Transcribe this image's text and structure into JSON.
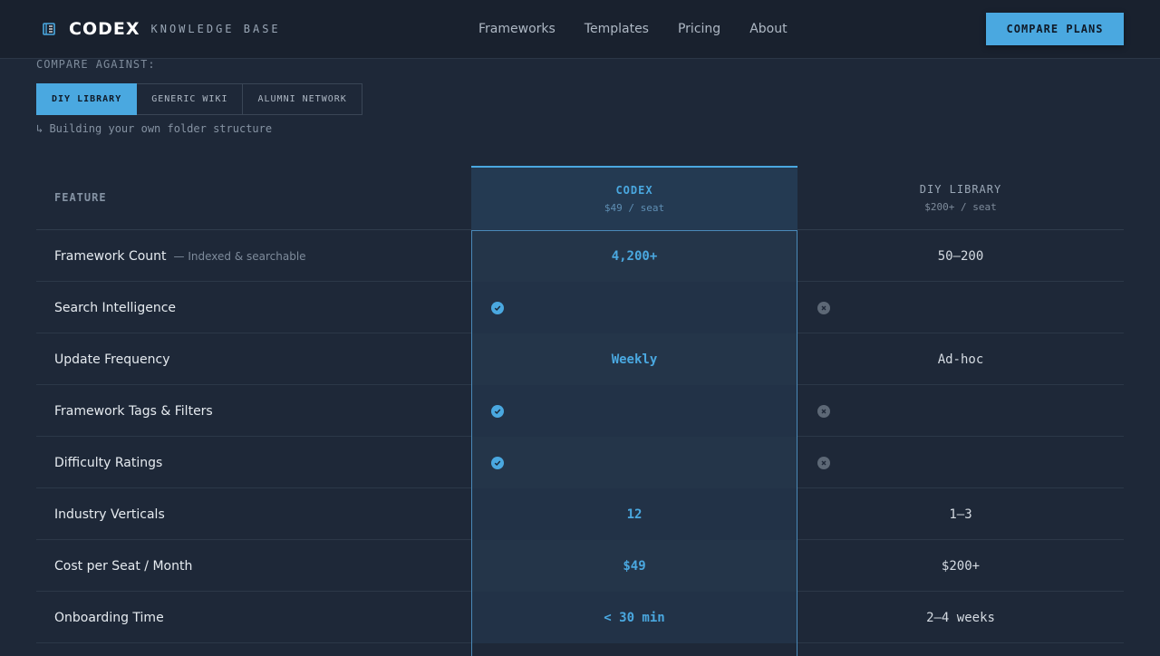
{
  "header": {
    "brand_name": "CODEX",
    "brand_sub": "KNOWLEDGE BASE",
    "nav": [
      "Frameworks",
      "Templates",
      "Pricing",
      "About"
    ],
    "cta_label": "COMPARE PLANS"
  },
  "compare": {
    "label": "COMPARE AGAINST:",
    "options": [
      "DIY LIBRARY",
      "GENERIC WIKI",
      "ALUMNI NETWORK"
    ],
    "selected": "DIY LIBRARY",
    "hint": "↳ Building your own folder structure"
  },
  "table": {
    "feature_header": "FEATURE",
    "codex_header": "CODEX",
    "codex_price": "$49 / seat",
    "diy_header": "DIY LIBRARY",
    "diy_price": "$200+ / seat",
    "rows": [
      {
        "feature": "Framework Count",
        "note": "— Indexed & searchable",
        "codex": "4,200+",
        "diy": "50–200"
      },
      {
        "feature": "Search Intelligence",
        "note": "",
        "codex": "check",
        "diy": "cross"
      },
      {
        "feature": "Update Frequency",
        "note": "",
        "codex": "Weekly",
        "diy": "Ad-hoc"
      },
      {
        "feature": "Framework Tags & Filters",
        "note": "",
        "codex": "check",
        "diy": "cross"
      },
      {
        "feature": "Difficulty Ratings",
        "note": "",
        "codex": "check",
        "diy": "cross"
      },
      {
        "feature": "Industry Verticals",
        "note": "",
        "codex": "12",
        "diy": "1–3"
      },
      {
        "feature": "Cost per Seat / Month",
        "note": "",
        "codex": "$49",
        "diy": "$200+"
      },
      {
        "feature": "Onboarding Time",
        "note": "",
        "codex": "< 30 min",
        "diy": "2–4 weeks"
      }
    ]
  },
  "colors": {
    "accent": "#4aa8e0",
    "background": "#1e2838",
    "topbar": "#19212e"
  }
}
